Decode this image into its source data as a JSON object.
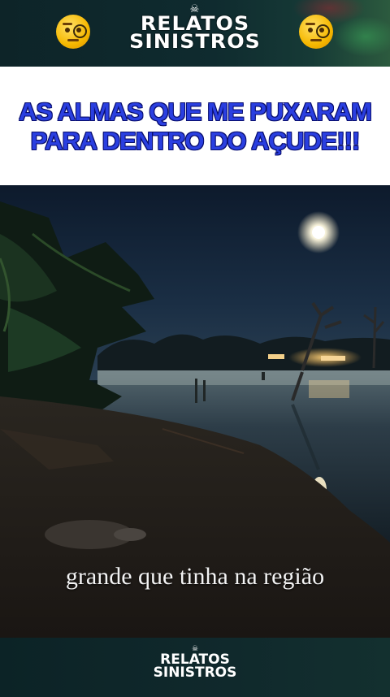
{
  "header": {
    "logo_line1": "RELATOS",
    "logo_line2": "SINISTROS",
    "emoji_left": "face-with-monocle",
    "emoji_right": "face-with-monocle"
  },
  "title": {
    "line1": "AS ALMAS QUE ME PUXARAM",
    "line2": "PARA DENTRO DO AÇUDE!!!"
  },
  "video": {
    "caption": "grande que tinha na região"
  },
  "footer": {
    "logo_line1": "RELATOS",
    "logo_line2": "SINISTROS"
  },
  "colors": {
    "title_blue": "#2a3fe0",
    "banner_dark": "#0f2b2f"
  }
}
